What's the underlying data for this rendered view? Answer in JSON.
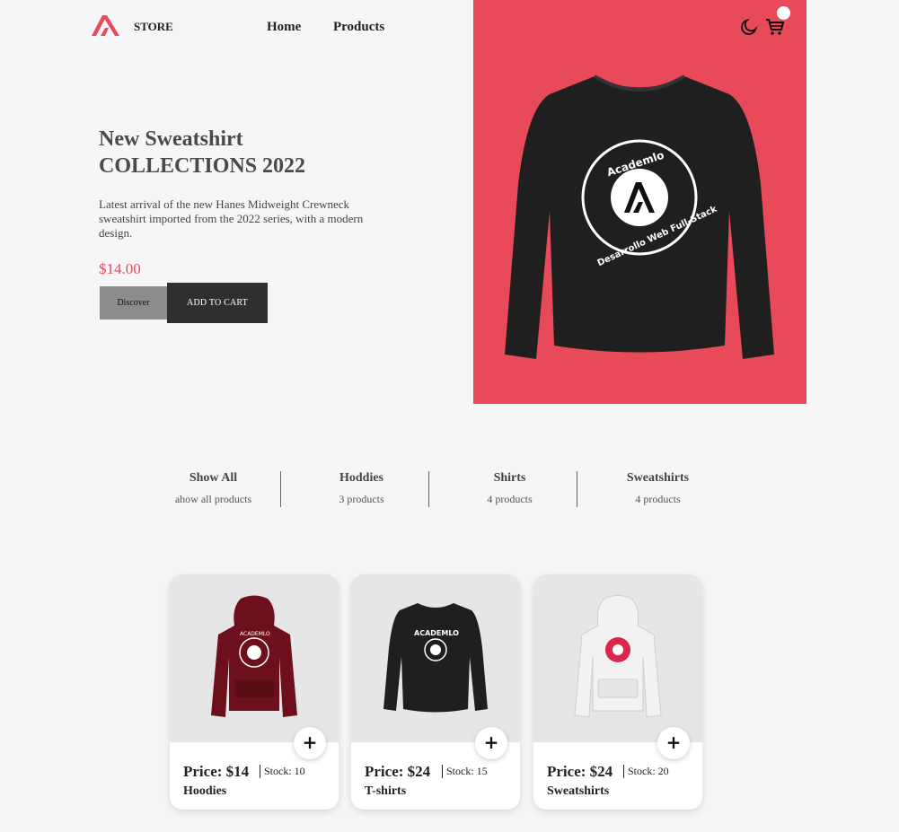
{
  "header": {
    "store": "STORE",
    "nav": [
      "Home",
      "Products"
    ]
  },
  "colors": {
    "accent": "#e94a5a",
    "dark": "#2f2f2f",
    "muted": "#8c8c8c"
  },
  "hero": {
    "title_line1": "New Sweatshirt",
    "title_line2": "COLLECTIONS 2022",
    "description": "Latest arrival of the new Hanes Midweight Crewneck sweatshirt imported from the 2022 series, with a modern design.",
    "price": "$14.00",
    "discover_label": "Discover",
    "add_label": "ADD TO CART",
    "print_brand": "Academlo",
    "print_tag": "Desarrollo Web Full-Stack"
  },
  "filters": [
    {
      "title": "Show All",
      "sub": "ahow all products"
    },
    {
      "title": "Hoddies",
      "sub": "3 products"
    },
    {
      "title": "Shirts",
      "sub": "4 products"
    },
    {
      "title": "Sweatshirts",
      "sub": "4 products"
    }
  ],
  "products": [
    {
      "price": "Price: $14",
      "stock": "Stock: 10",
      "category": "Hoodies",
      "color": "#6e0f1c",
      "print": "ACADEMLO"
    },
    {
      "price": "Price: $24",
      "stock": "Stock: 15",
      "category": "T-shirts",
      "color": "#1f1f1f",
      "print": "ACADEMLO"
    },
    {
      "price": "Price: $24",
      "stock": "Stock: 20",
      "category": "Sweatshirts",
      "color": "#e3e3e3",
      "print": ""
    }
  ],
  "icons": [
    "logo-icon",
    "moon-icon",
    "cart-icon",
    "plus-icon"
  ]
}
